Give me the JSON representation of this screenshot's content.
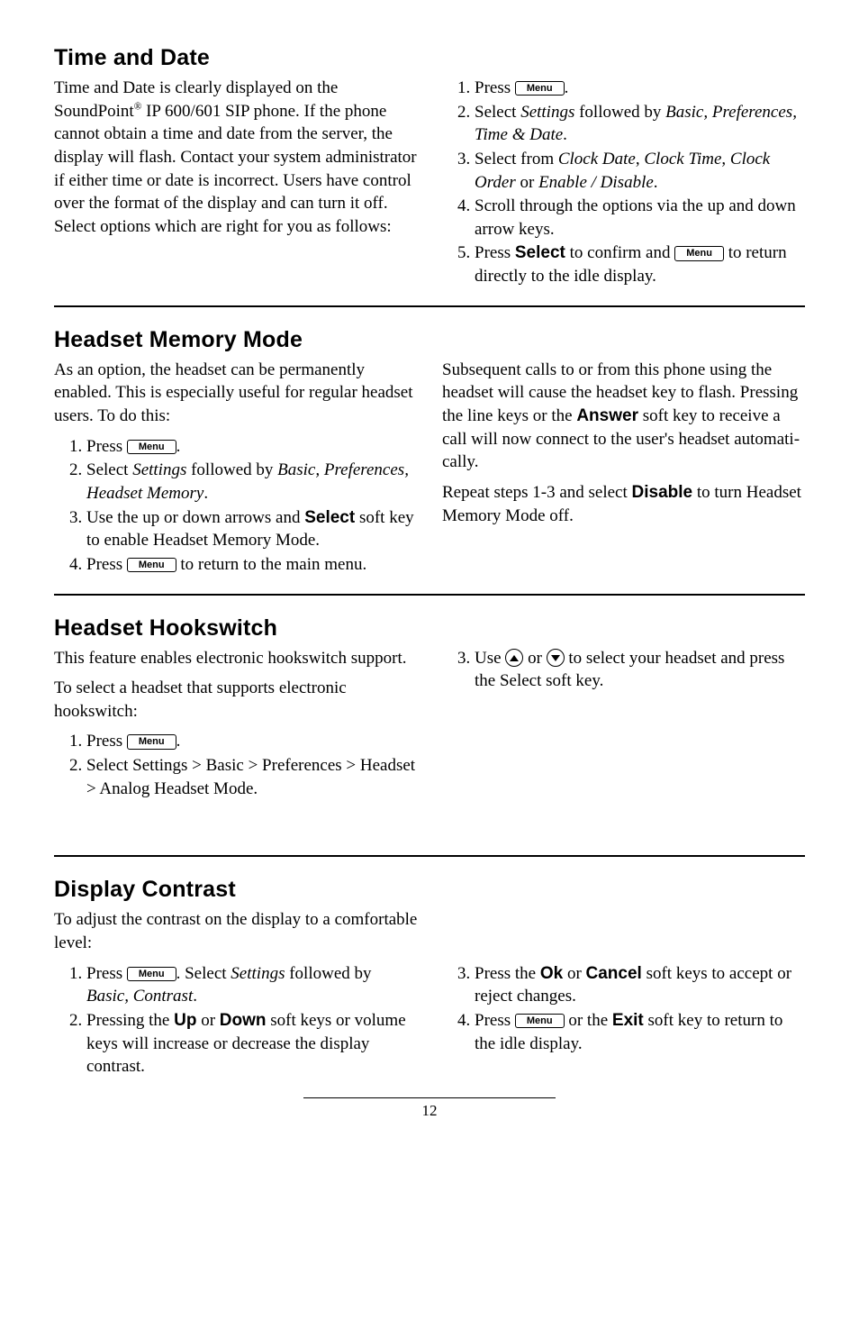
{
  "menuLabel": "Menu",
  "pageNumber": "12",
  "timeAndDate": {
    "heading": "Time and Date",
    "intro_a": "Time and Date is clearly displayed on the SoundPoint",
    "intro_reg": "®",
    "intro_b": " IP 600/601 SIP phone.  If the phone cannot obtain a time and date from the server, the display will flash.  Contact your system administrator if either time or date is incorrect.  Users have control over the format of the display and can turn it off.  Select options which are right for you as follows:",
    "step1_a": "Press ",
    "step1_b": ".",
    "step2_a": "Select ",
    "step2_i1": "Settings",
    "step2_b": " followed by ",
    "step2_i2": "Basic, Preferences, Time & Date",
    "step2_c": ".",
    "step3_a": "Select from ",
    "step3_i1": "Clock Date",
    "step3_b": ", ",
    "step3_i2": "Clock Time",
    "step3_c": ", ",
    "step3_i3": "Clock Order",
    "step3_d": " or ",
    "step3_i4": "Enable / Disable",
    "step3_e": ".",
    "step4": "Scroll through the options via the up and down arrow keys.",
    "step5_a": "Press ",
    "step5_sk": "Select",
    "step5_b": " to confirm and ",
    "step5_c": " to return directly to the idle display."
  },
  "headsetMemory": {
    "heading": "Headset Memory Mode",
    "intro": "As an option, the headset can be perma­nently enabled.  This is especially useful for regular headset users.  To do this:",
    "step1_a": "Press ",
    "step1_b": ".",
    "step2_a": "Select ",
    "step2_i1": "Settings",
    "step2_b": " followed by ",
    "step2_i2": "Basic, Preferences, Headset Memory",
    "step2_c": ".",
    "step3_a": "Use the up or down arrows and ",
    "step3_sk": "Select",
    "step3_b": " soft key to enable Headset Memory Mode.",
    "step4_a": "Press ",
    "step4_b": " to return to the main menu.",
    "right_a": "Subsequent calls to or from this phone using the headset will cause the headset key to flash.  Pressing the line keys or the ",
    "right_sk": "Answer",
    "right_b": " soft key to receive a call will now connect to the user's headset automati­cally.",
    "right2_a": "Repeat steps 1-3 and select ",
    "right2_sk": "Disable",
    "right2_b": " to turn Headset Memory Mode off."
  },
  "headsetHookswitch": {
    "heading": "Headset Hookswitch",
    "intro": "This feature enables electronic hookswitch support.",
    "intro2": "To select a headset that supports electronic hookswitch:",
    "step1_a": "Press ",
    "step1_b": ".",
    "step2": "Select Settings > Basic > Preferences > Headset > Analog Headset Mode.",
    "right_step3_a": "Use ",
    "right_step3_b": " or ",
    "right_step3_c": " to select your headset and press the Select soft key."
  },
  "displayContrast": {
    "heading": "Display Contrast",
    "intro": "To adjust the contrast on the display to a comfortable level:",
    "step1_a": "Press ",
    "step1_b": ".  Select ",
    "step1_i1": "Settings",
    "step1_c": " fol­lowed by ",
    "step1_i2": "Basic, Contrast",
    "step1_d": ".",
    "step2_a": "Pressing the ",
    "step2_sk1": "Up",
    "step2_b": " or ",
    "step2_sk2": "Down",
    "step2_c": " soft keys or volume keys will increase or decrease the display contrast.",
    "step3_a": "Press the ",
    "step3_sk1": "Ok",
    "step3_b": " or ",
    "step3_sk2": "Cancel",
    "step3_c": " soft keys to accept or reject changes.",
    "step4_a": "Press ",
    "step4_b": " or the ",
    "step4_sk": "Exit",
    "step4_c": " soft key to return to the idle display."
  }
}
